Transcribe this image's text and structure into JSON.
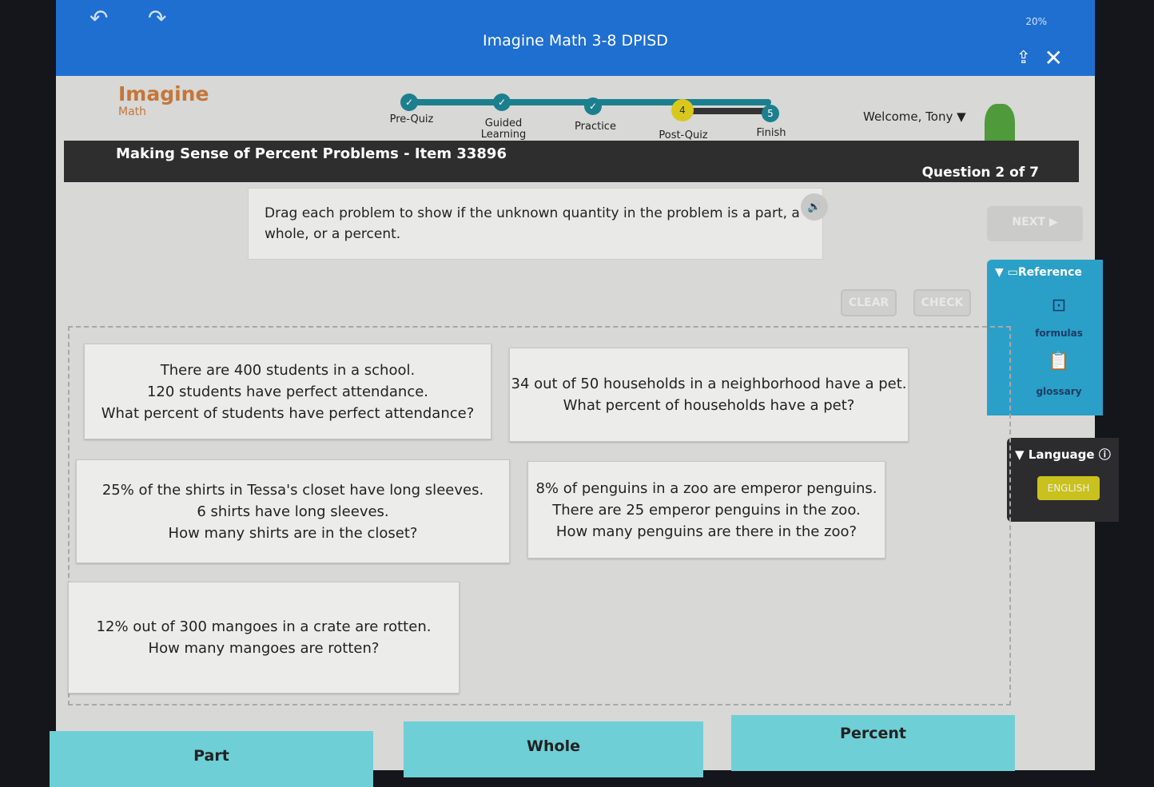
{
  "topbar": {
    "title": "Imagine Math 3-8 DPISD",
    "status": "20%"
  },
  "logo": {
    "line1": "Imagine",
    "line2": "Math"
  },
  "progress": {
    "steps": [
      {
        "label": "Pre-Quiz",
        "state": "done"
      },
      {
        "label": "Guided Learning",
        "state": "done"
      },
      {
        "label": "Practice",
        "state": "done"
      },
      {
        "label": "Post-Quiz",
        "state": "current",
        "num": "4"
      },
      {
        "label": "Finish",
        "state": "upcoming",
        "num": "5"
      }
    ]
  },
  "user": {
    "welcome": "Welcome, Tony"
  },
  "header": {
    "title": "Making Sense of Percent Problems - Item 33896",
    "question": "Question 2 of 7"
  },
  "instructions": "Drag each problem to show if the unknown quantity in the problem is a part, a whole, or a percent.",
  "buttons": {
    "next": "NEXT ▶",
    "clear": "CLEAR",
    "check": "CHECK"
  },
  "reference": {
    "title": "Reference",
    "formulas": "formulas",
    "glossary": "glossary"
  },
  "language": {
    "title": "Language",
    "value": "ENGLISH"
  },
  "cards": [
    [
      "There are 400 students in a school.",
      "120 students have perfect attendance.",
      "What percent of students have perfect attendance?"
    ],
    [
      "34 out of 50 households in a neighborhood have a pet.",
      "What percent of households have a pet?"
    ],
    [
      "25% of the shirts in Tessa's closet have long sleeves.",
      "6 shirts have long sleeves.",
      "How many shirts are in the closet?"
    ],
    [
      "8% of penguins in a zoo are emperor penguins.",
      "There are 25 emperor penguins in the zoo.",
      "How many penguins are there in the zoo?"
    ],
    [
      "12% out of 300 mangoes in a crate are rotten.",
      "How many mangoes are rotten?"
    ]
  ],
  "bins": [
    "Part",
    "Whole",
    "Percent"
  ]
}
